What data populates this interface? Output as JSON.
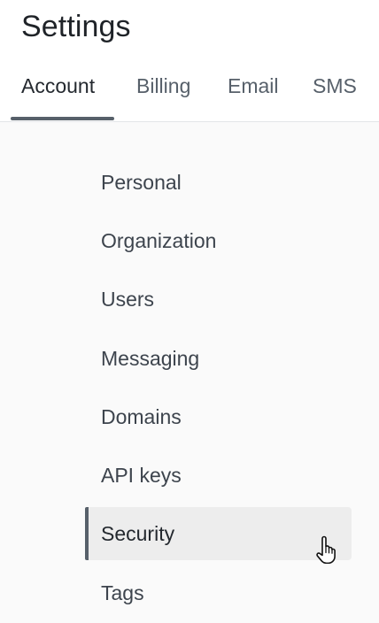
{
  "page": {
    "title": "Settings"
  },
  "tabs": [
    {
      "label": "Account",
      "active": true
    },
    {
      "label": "Billing",
      "active": false
    },
    {
      "label": "Email",
      "active": false
    },
    {
      "label": "SMS",
      "active": false
    }
  ],
  "nav": {
    "items": [
      {
        "label": "Personal",
        "active": false
      },
      {
        "label": "Organization",
        "active": false
      },
      {
        "label": "Users",
        "active": false
      },
      {
        "label": "Messaging",
        "active": false
      },
      {
        "label": "Domains",
        "active": false
      },
      {
        "label": "API keys",
        "active": false
      },
      {
        "label": "Security",
        "active": true
      },
      {
        "label": "Tags",
        "active": false
      }
    ]
  },
  "icons": {
    "cursor": "hand-pointer-icon"
  },
  "colors": {
    "accent": "#57606a",
    "active_background": "#ededed",
    "content_background": "#fafafa"
  }
}
